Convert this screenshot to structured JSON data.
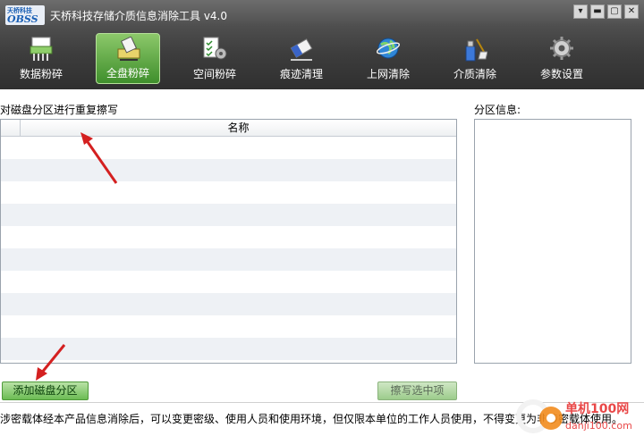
{
  "window": {
    "logo_top": "天桥科技",
    "logo_main": "OBSS",
    "title": "天桥科技存储介质信息消除工具 v4.0",
    "controls": {
      "settings": "▾",
      "minimize": "▬",
      "maximize": "▢",
      "close": "✕"
    }
  },
  "tabs": [
    {
      "label": "数据粉碎",
      "icon": "shredder-icon",
      "active": false
    },
    {
      "label": "全盘粉碎",
      "icon": "disk-shred-icon",
      "active": true
    },
    {
      "label": "空间粉碎",
      "icon": "space-shred-icon",
      "active": false
    },
    {
      "label": "痕迹清理",
      "icon": "eraser-icon",
      "active": false
    },
    {
      "label": "上网清除",
      "icon": "globe-icon",
      "active": false
    },
    {
      "label": "介质清除",
      "icon": "usb-brush-icon",
      "active": false
    },
    {
      "label": "参数设置",
      "icon": "gear-icon",
      "active": false
    }
  ],
  "main": {
    "section_label": "对磁盘分区进行重复擦写",
    "list_header": "名称",
    "partition_info_label": "分区信息:",
    "add_button": "添加磁盘分区",
    "wipe_button": "擦写选中项",
    "footer_note": "涉密载体经本产品信息消除后，可以变更密级、使用人员和使用环境，但仅限本单位的工作人员使用，不得变更为非涉密载体使用。"
  },
  "watermark": {
    "text": "单机100网",
    "url": "danji100.com"
  },
  "colors": {
    "accent_green": "#3f8f2c",
    "arrow_red": "#d42020"
  }
}
